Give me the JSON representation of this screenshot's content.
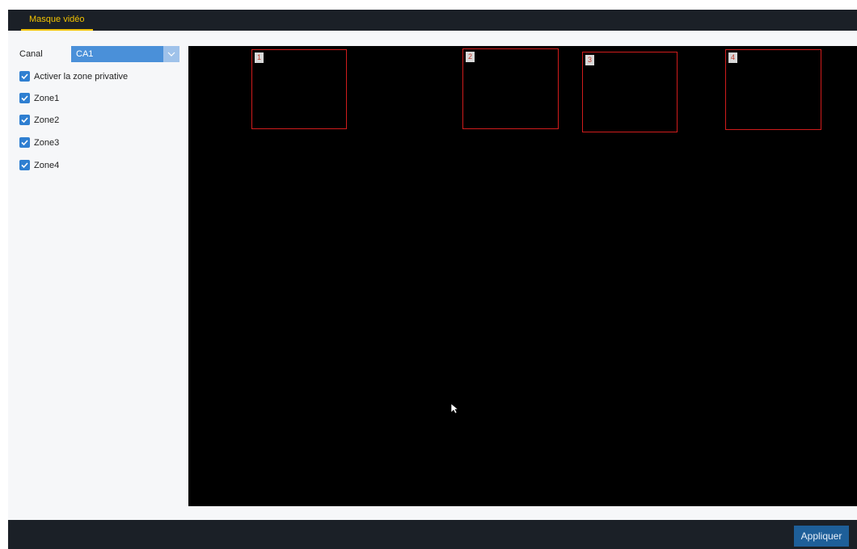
{
  "tabs": [
    {
      "label": "Masque vidéo",
      "active": true
    }
  ],
  "channel": {
    "label": "Canal",
    "value": "CA1"
  },
  "privacy": {
    "enable_label": "Activer la zone privative",
    "enabled": true,
    "zones": [
      {
        "label": "Zone1",
        "checked": true
      },
      {
        "label": "Zone2",
        "checked": true
      },
      {
        "label": "Zone3",
        "checked": true
      },
      {
        "label": "Zone4",
        "checked": true
      }
    ]
  },
  "video": {
    "zone_numbers": [
      "1",
      "2",
      "3",
      "4"
    ]
  },
  "footer": {
    "apply_label": "Appliquer"
  },
  "colors": {
    "accent": "#f2c200",
    "checkbox": "#2f7fd1",
    "zone_border": "#d01c1c",
    "apply_button": "#1e5f99"
  }
}
